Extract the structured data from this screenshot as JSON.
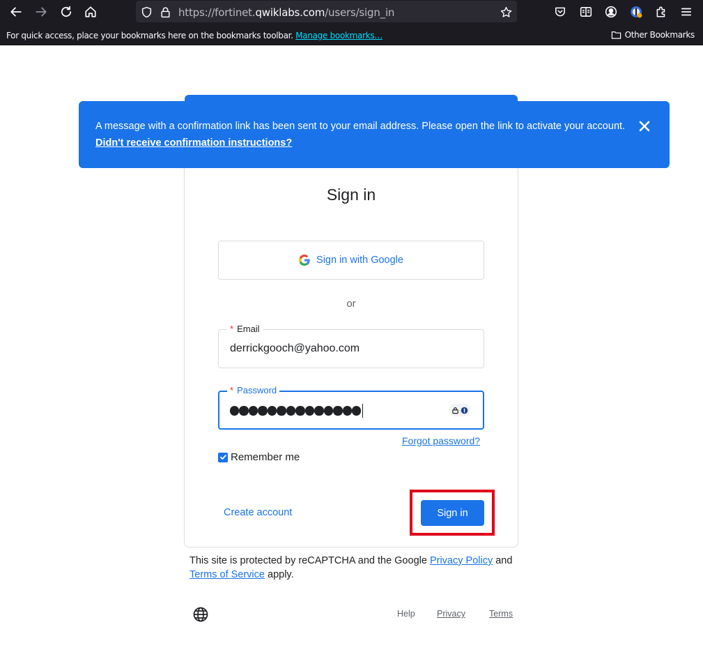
{
  "browser": {
    "url_prefix": "https://fortinet.",
    "url_host": "qwiklabs.com",
    "url_path": "/users/sign_in",
    "bookmarks_hint": "For quick access, place your bookmarks here on the bookmarks toolbar.",
    "manage_bookmarks": "Manage bookmarks…",
    "other_bookmarks": "Other Bookmarks"
  },
  "banner": {
    "message": "A message with a confirmation link has been sent to your email address. Please open the link to activate your account.",
    "link": "Didn't receive confirmation instructions?"
  },
  "form": {
    "title": "Sign in",
    "google_button": "Sign in with Google",
    "or": "or",
    "email_label": "Email",
    "email_value": "derrickgooch@yahoo.com",
    "password_label": "Password",
    "password_length": 14,
    "required_mark": "*",
    "forgot_password": "Forgot password?",
    "remember_me": "Remember me",
    "remember_checked": true,
    "create_account": "Create account",
    "sign_in_button": "Sign in"
  },
  "recaptcha": {
    "prefix": "This site is protected by reCAPTCHA and the Google",
    "privacy_link": "Privacy Policy",
    "and": "and",
    "terms_link": "Terms of Service",
    "suffix": "apply."
  },
  "footer": {
    "help": "Help",
    "privacy": "Privacy",
    "terms": "Terms"
  },
  "colors": {
    "accent": "#1a73e8",
    "highlight": "#e0001b",
    "required": "#d93025"
  },
  "icons": [
    "back-arrow-icon",
    "forward-arrow-icon",
    "reload-icon",
    "home-icon",
    "shield-icon",
    "lock-icon",
    "star-icon",
    "pocket-icon",
    "reader-icon",
    "account-icon",
    "extension-avatar-icon",
    "extensions-icon",
    "menu-icon",
    "folder-icon",
    "close-icon",
    "google-g-icon",
    "password-manager-icon",
    "check-icon",
    "globe-icon"
  ]
}
